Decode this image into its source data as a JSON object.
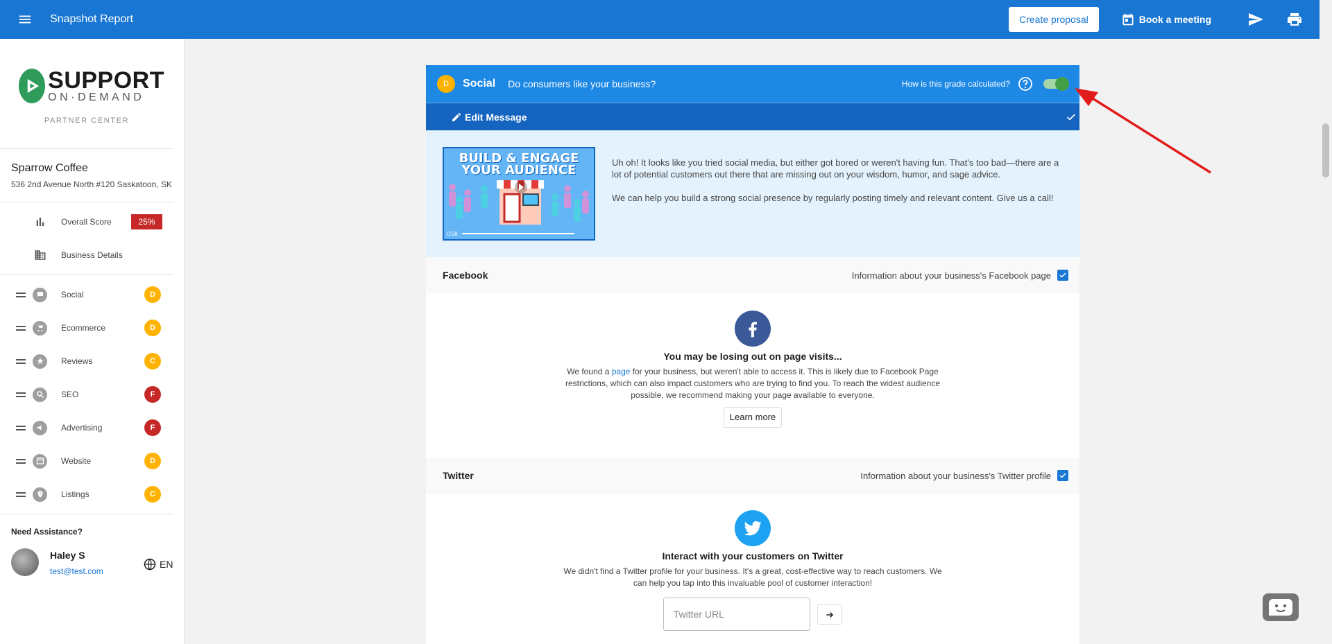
{
  "header": {
    "title": "Snapshot Report",
    "create_proposal": "Create proposal",
    "book_meeting": "Book a meeting"
  },
  "sidebar": {
    "logo_main": "SUPPORT",
    "logo_sub": "ON·DEMAND",
    "partner_center": "PARTNER CENTER",
    "business_name": "Sparrow Coffee",
    "business_address": "536 2nd Avenue North #120 Saskatoon, SK",
    "overall_score_label": "Overall Score",
    "overall_score_value": "25%",
    "business_details_label": "Business Details",
    "sections": [
      {
        "label": "Social",
        "grade": "D",
        "color": "#ffb300"
      },
      {
        "label": "Ecommerce",
        "grade": "D",
        "color": "#ffb300"
      },
      {
        "label": "Reviews",
        "grade": "C",
        "color": "#ffb300"
      },
      {
        "label": "SEO",
        "grade": "F",
        "color": "#c62828"
      },
      {
        "label": "Advertising",
        "grade": "F",
        "color": "#c62828"
      },
      {
        "label": "Website",
        "grade": "D",
        "color": "#ffb300"
      },
      {
        "label": "Listings",
        "grade": "C",
        "color": "#ffb300"
      }
    ],
    "need_assistance": "Need Assistance?",
    "agent_name": "Haley S",
    "agent_email": "test@test.com",
    "language": "EN"
  },
  "card": {
    "grade": "D",
    "title": "Social",
    "subtitle": "Do consumers like your business?",
    "calc_label": "How is this grade calculated?",
    "toggle_on": true,
    "edit_message": "Edit Message",
    "video": {
      "title_line1": "BUILD & ENGAGE",
      "title_line2": "YOUR AUDIENCE",
      "time": "0:58"
    },
    "message_p1": "Uh oh! It looks like you tried social media, but either got bored or weren't having fun. That's too bad—there are a lot of potential customers out there that are missing out on your wisdom, humor, and sage advice.",
    "message_p2": "We can help you build a strong social presence by regularly posting timely and relevant content. Give us a call!",
    "facebook": {
      "name": "Facebook",
      "info": "Information about your business's Facebook page",
      "title": "You may be losing out on page visits...",
      "text_before": "We found a ",
      "link": "page",
      "text_after": " for your business, but weren't able to access it. This is likely due to Facebook Page restrictions, which can also impact customers who are trying to find you. To reach the widest audience possible, we recommend making your page available to everyone.",
      "button": "Learn more"
    },
    "twitter": {
      "name": "Twitter",
      "info": "Information about your business's Twitter profile",
      "title": "Interact with your customers on Twitter",
      "text": "We didn't find a Twitter profile for your business. It's a great, cost-effective way to reach customers. We can help you tap into this invaluable pool of customer interaction!",
      "input_placeholder": "Twitter URL"
    }
  },
  "colors": {
    "primary": "#1976d2",
    "header_blue": "#1e88e5",
    "grade_d": "#ffb300",
    "grade_f": "#c62828",
    "toggle_green": "#43a047",
    "annotation_red": "#e31b1b"
  }
}
